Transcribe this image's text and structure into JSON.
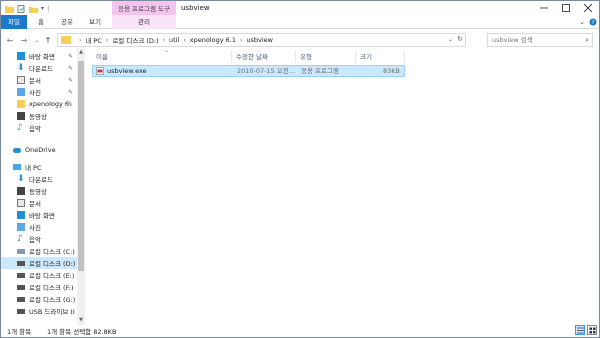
{
  "window": {
    "title": "usbview",
    "context_tool_group": "응용 프로그램 도구"
  },
  "ribbon": {
    "tabs": {
      "file": "파일",
      "home": "홈",
      "share": "공유",
      "view": "보기",
      "manage": "관리"
    }
  },
  "address": {
    "segments": [
      "내 PC",
      "로컬 디스크 (D:)",
      "util",
      "xpenology 6.1",
      "usbview"
    ],
    "search_placeholder": "usbview 검색"
  },
  "navigation": {
    "quick_access": [
      {
        "label": "바탕 화면",
        "pinned": true
      },
      {
        "label": "다운로드",
        "pinned": true
      },
      {
        "label": "문서",
        "pinned": true
      },
      {
        "label": "사진",
        "pinned": true
      },
      {
        "label": "xpenology 6.",
        "pinned": true
      },
      {
        "label": "동영상",
        "pinned": false
      },
      {
        "label": "음악",
        "pinned": false
      }
    ],
    "onedrive": "OneDrive",
    "this_pc": "내 PC",
    "pc_items": [
      {
        "label": "다운로드"
      },
      {
        "label": "동영상"
      },
      {
        "label": "문서"
      },
      {
        "label": "바탕 화면"
      },
      {
        "label": "사진"
      },
      {
        "label": "음악"
      },
      {
        "label": "로컬 디스크 (C:)"
      },
      {
        "label": "로컬 디스크 (D:)"
      },
      {
        "label": "로컬 디스크 (E:)"
      },
      {
        "label": "로컬 디스크 (F:)"
      },
      {
        "label": "로컬 디스크 (G:)"
      },
      {
        "label": "USB 드라이브 (I"
      }
    ]
  },
  "columns": {
    "name": "이름",
    "modified": "수정한 날짜",
    "type": "유형",
    "size": "크기"
  },
  "files": [
    {
      "name": "usbview.exe",
      "modified": "2010-07-15 오전...",
      "type": "응용 프로그램",
      "size": "83KB"
    }
  ],
  "status": {
    "item_count": "1개 항목",
    "selection": "1개 항목 선택함 82.8KB"
  },
  "colors": {
    "file_tab": "#1979ca",
    "context_tool": "#f3c5ee",
    "selection": "#cce8ff",
    "folder": "#f6cf5b"
  }
}
